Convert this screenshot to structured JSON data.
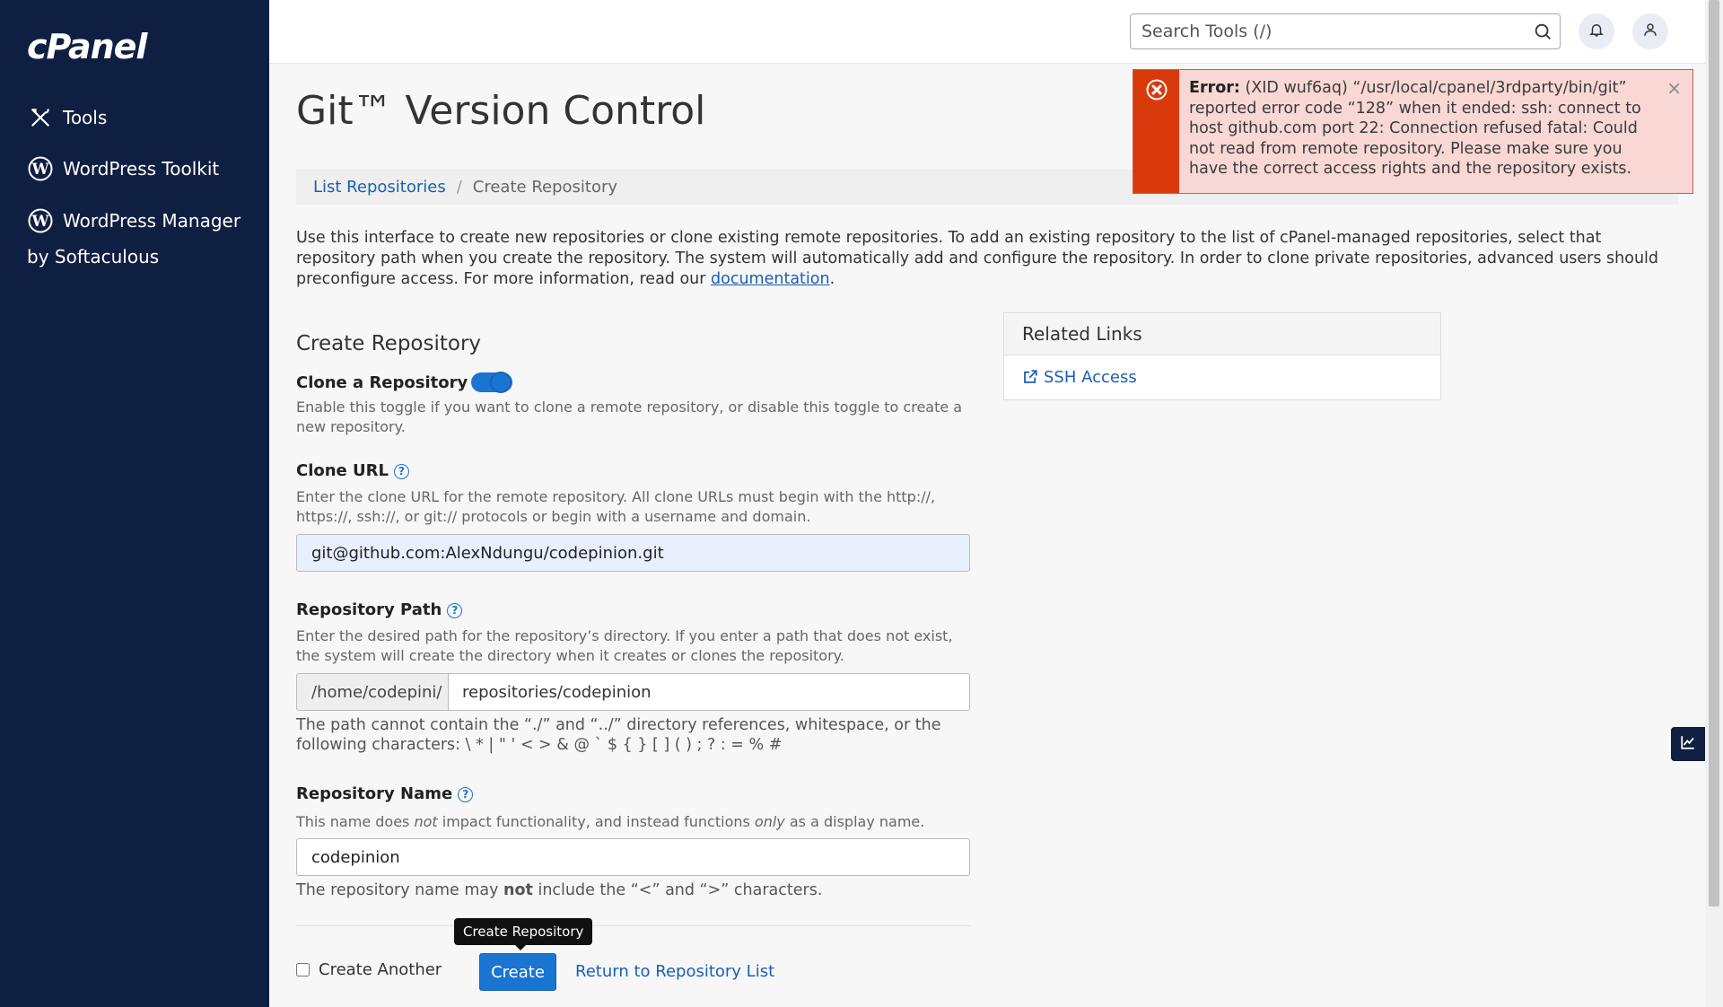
{
  "sidebar": {
    "logo": "cPanel",
    "items": [
      {
        "label": "Tools",
        "icon": "tools-icon"
      },
      {
        "label": "WordPress Toolkit",
        "icon": "wordpress-icon"
      },
      {
        "label": "WordPress Manager",
        "icon": "wordpress-icon"
      }
    ],
    "item3_line2": "by Softaculous"
  },
  "header": {
    "search_placeholder": "Search Tools (/)"
  },
  "page": {
    "title": "Git™ Version Control",
    "breadcrumb": {
      "link": "List Repositories",
      "separator": "/",
      "current": "Create Repository"
    },
    "intro": "Use this interface to create new repositories or clone existing remote repositories. To add an existing repository to the list of cPanel-managed repositories, select that repository path when you create the repository. The system will automatically add and configure the repository. In order to clone private repositories, advanced users should preconfigure access. For more information, read our",
    "intro_link": "documentation",
    "intro_end": "."
  },
  "form": {
    "heading": "Create Repository",
    "clone_label": "Clone a Repository",
    "clone_enabled": true,
    "clone_help": "Enable this toggle if you want to clone a remote repository, or disable this toggle to create a new repository.",
    "url_label": "Clone URL",
    "url_help": "Enter the clone URL for the remote repository. All clone URLs must begin with the http://, https://, ssh://, or git:// protocols or begin with a username and domain.",
    "url_value": "git@github.com:AlexNdungu/codepinion.git",
    "path_label": "Repository Path",
    "path_help": "Enter the desired path for the repository’s directory. If you enter a path that does not exist, the system will create the directory when it creates or clones the repository.",
    "path_prefix": "/home/codepini/",
    "path_value": "repositories/codepinion",
    "path_note": "The path cannot contain the “./” and “../” directory references, whitespace, or the following characters: \\ * | \" ' < > & @ ` $ { } [ ] ( ) ; ? : = % #",
    "name_label": "Repository Name",
    "name_help_1": "This name does ",
    "name_help_not": "not",
    "name_help_2": " impact functionality, and instead functions ",
    "name_help_only": "only",
    "name_help_3": " as a display name.",
    "name_value": "codepinion",
    "name_note_1": "The repository name may ",
    "name_note_bold": "not",
    "name_note_2": " include the “<” and “>” characters.",
    "create_another_label": "Create Another",
    "create_another_checked": false,
    "tooltip": "Create Repository",
    "create_button": "Create",
    "return_link": "Return to Repository List"
  },
  "related_links": {
    "heading": "Related Links",
    "items": [
      {
        "label": "SSH Access",
        "icon": "external-link-icon"
      }
    ]
  },
  "alert": {
    "type": "error",
    "title": "Error:",
    "message": "(XID wuf6aq) “/usr/local/cpanel/3rdparty/bin/git” reported error code “128” when it ended: ssh: connect to host github.com port 22: Connection refused fatal: Could not read from remote repository. Please make sure you have the correct access rights and the repository exists.",
    "close": "×"
  },
  "colors": {
    "sidebar_bg": "#0f1f42",
    "accent": "#1a74d2",
    "link": "#1a5fb4",
    "error_bar": "#d93a0b",
    "error_bg": "#f8d7d5"
  }
}
